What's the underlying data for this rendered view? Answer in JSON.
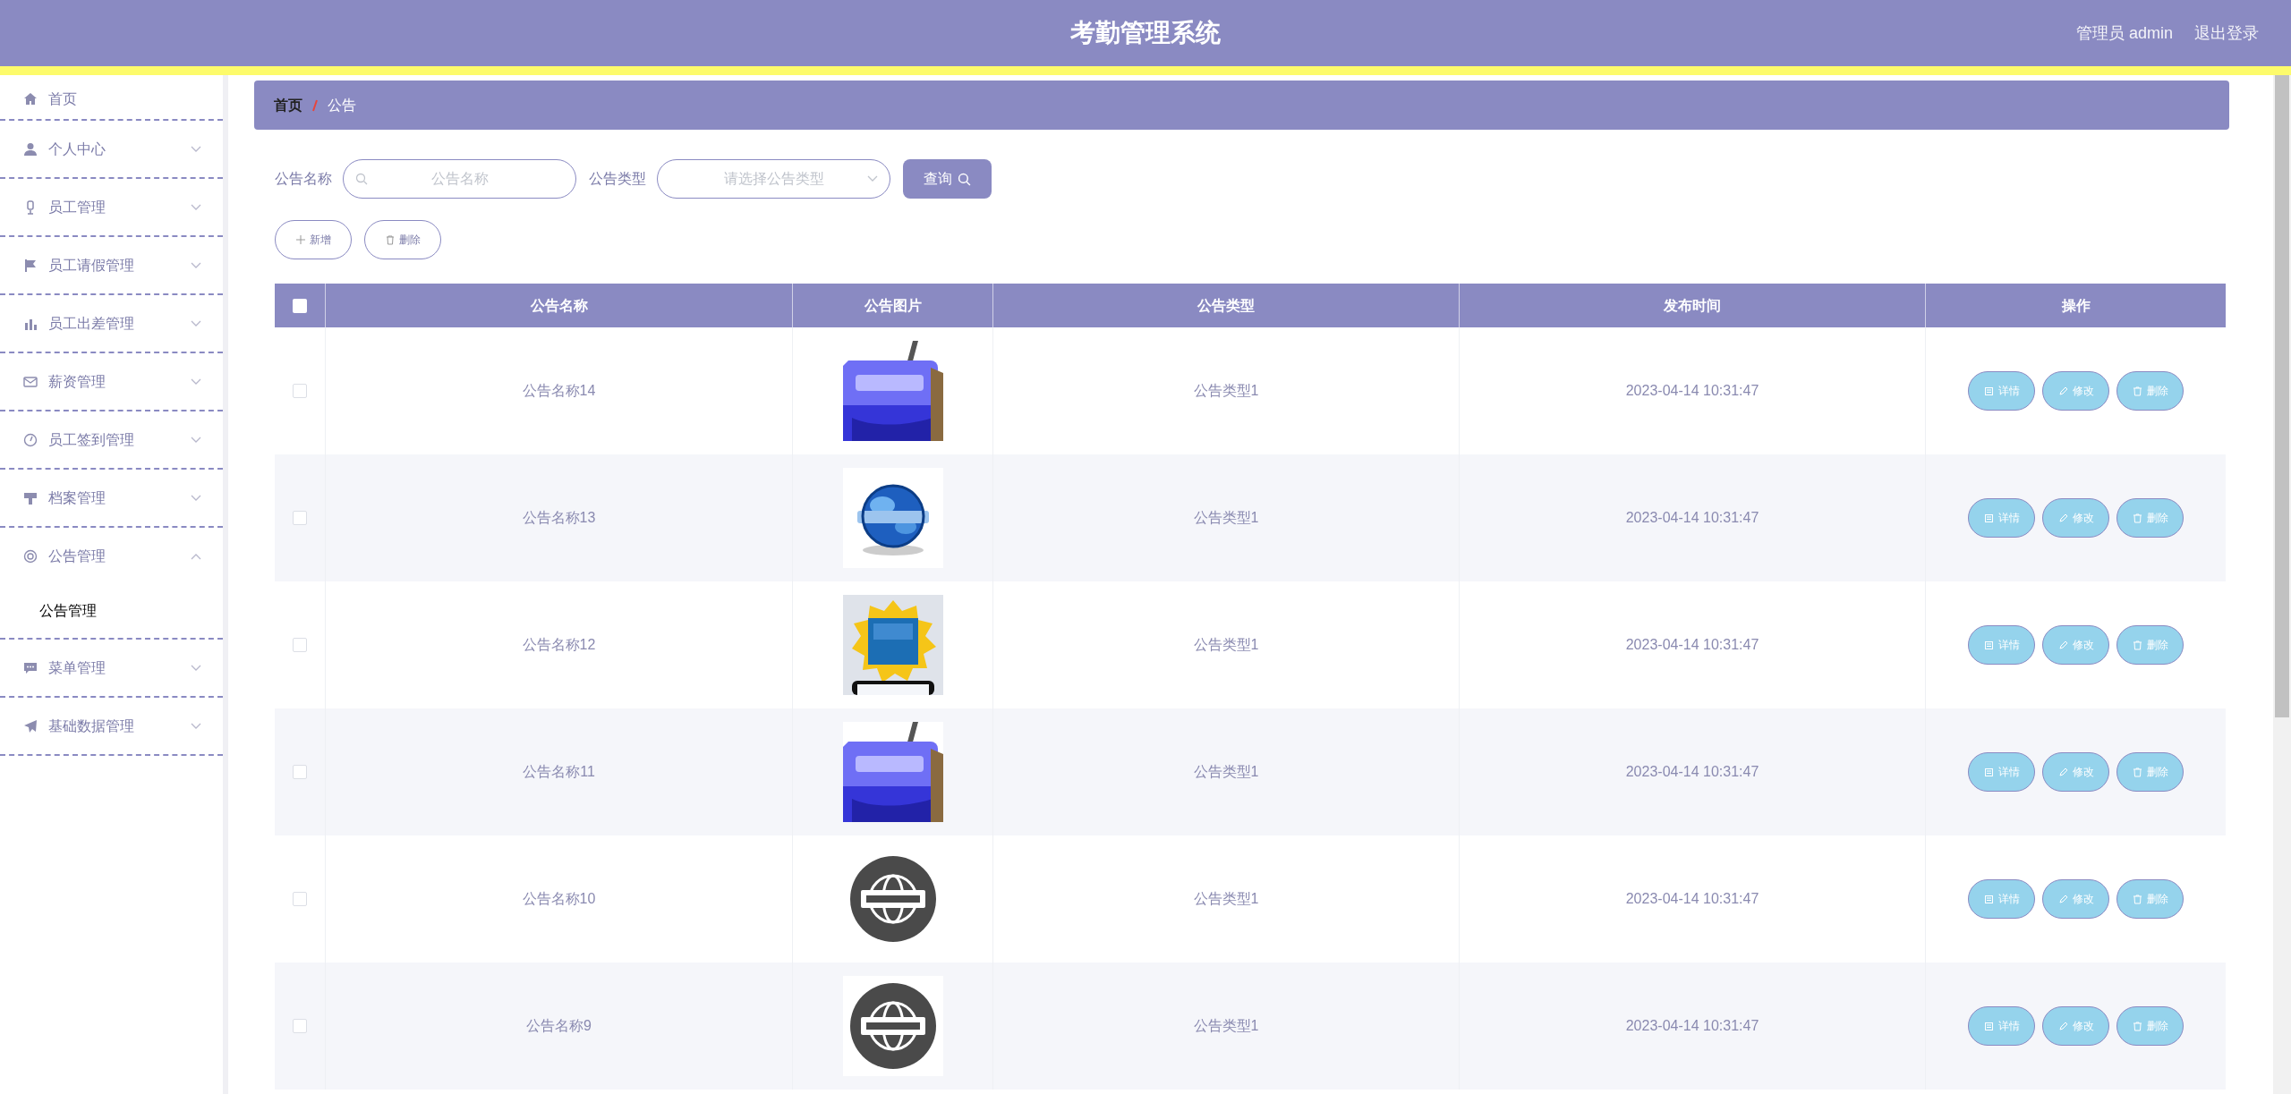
{
  "header": {
    "title": "考勤管理系统",
    "user": "管理员 admin",
    "logout": "退出登录"
  },
  "sidebar": {
    "items": [
      {
        "label": "首页",
        "kind": "link"
      },
      {
        "label": "个人中心",
        "kind": "menu",
        "expanded": false
      },
      {
        "label": "员工管理",
        "kind": "menu",
        "expanded": false
      },
      {
        "label": "员工请假管理",
        "kind": "menu",
        "expanded": false
      },
      {
        "label": "员工出差管理",
        "kind": "menu",
        "expanded": false
      },
      {
        "label": "薪资管理",
        "kind": "menu",
        "expanded": false
      },
      {
        "label": "员工签到管理",
        "kind": "menu",
        "expanded": false
      },
      {
        "label": "档案管理",
        "kind": "menu",
        "expanded": false
      },
      {
        "label": "公告管理",
        "kind": "menu",
        "expanded": true,
        "children": [
          {
            "label": "公告管理"
          }
        ]
      },
      {
        "label": "菜单管理",
        "kind": "menu",
        "expanded": false
      },
      {
        "label": "基础数据管理",
        "kind": "menu",
        "expanded": false
      }
    ]
  },
  "breadcrumb": [
    "首页",
    "公告"
  ],
  "search": {
    "fields": [
      {
        "label": "公告名称",
        "placeholder": "公告名称",
        "kind": "text"
      },
      {
        "label": "公告类型",
        "placeholder": "请选择公告类型",
        "kind": "select"
      }
    ],
    "button": "查询"
  },
  "actions": [
    {
      "label": "新增",
      "kind": "add"
    },
    {
      "label": "删除",
      "kind": "delete"
    }
  ],
  "table": {
    "header_checked": false,
    "columns": [
      "公告名称",
      "公告图片",
      "公告类型",
      "发布时间",
      "操作"
    ],
    "rows": [
      {
        "checked": false,
        "name": "公告名称14",
        "type": "公告类型1",
        "time": "2023-04-14 10:31:47",
        "actions": [
          "详情",
          "修改",
          "删除"
        ]
      },
      {
        "checked": false,
        "name": "公告名称13",
        "type": "公告类型1",
        "time": "2023-04-14 10:31:47",
        "actions": [
          "详情",
          "修改",
          "删除"
        ]
      },
      {
        "checked": false,
        "name": "公告名称12",
        "type": "公告类型1",
        "time": "2023-04-14 10:31:47",
        "actions": [
          "详情",
          "修改",
          "删除"
        ]
      },
      {
        "checked": false,
        "name": "公告名称11",
        "type": "公告类型1",
        "time": "2023-04-14 10:31:47",
        "actions": [
          "详情",
          "修改",
          "删除"
        ]
      },
      {
        "checked": false,
        "name": "公告名称10",
        "type": "公告类型1",
        "time": "2023-04-14 10:31:47",
        "actions": [
          "详情",
          "修改",
          "删除"
        ]
      },
      {
        "checked": false,
        "name": "公告名称9",
        "type": "公告类型1",
        "time": "2023-04-14 10:31:47",
        "actions": [
          "详情",
          "修改",
          "删除"
        ]
      }
    ]
  }
}
